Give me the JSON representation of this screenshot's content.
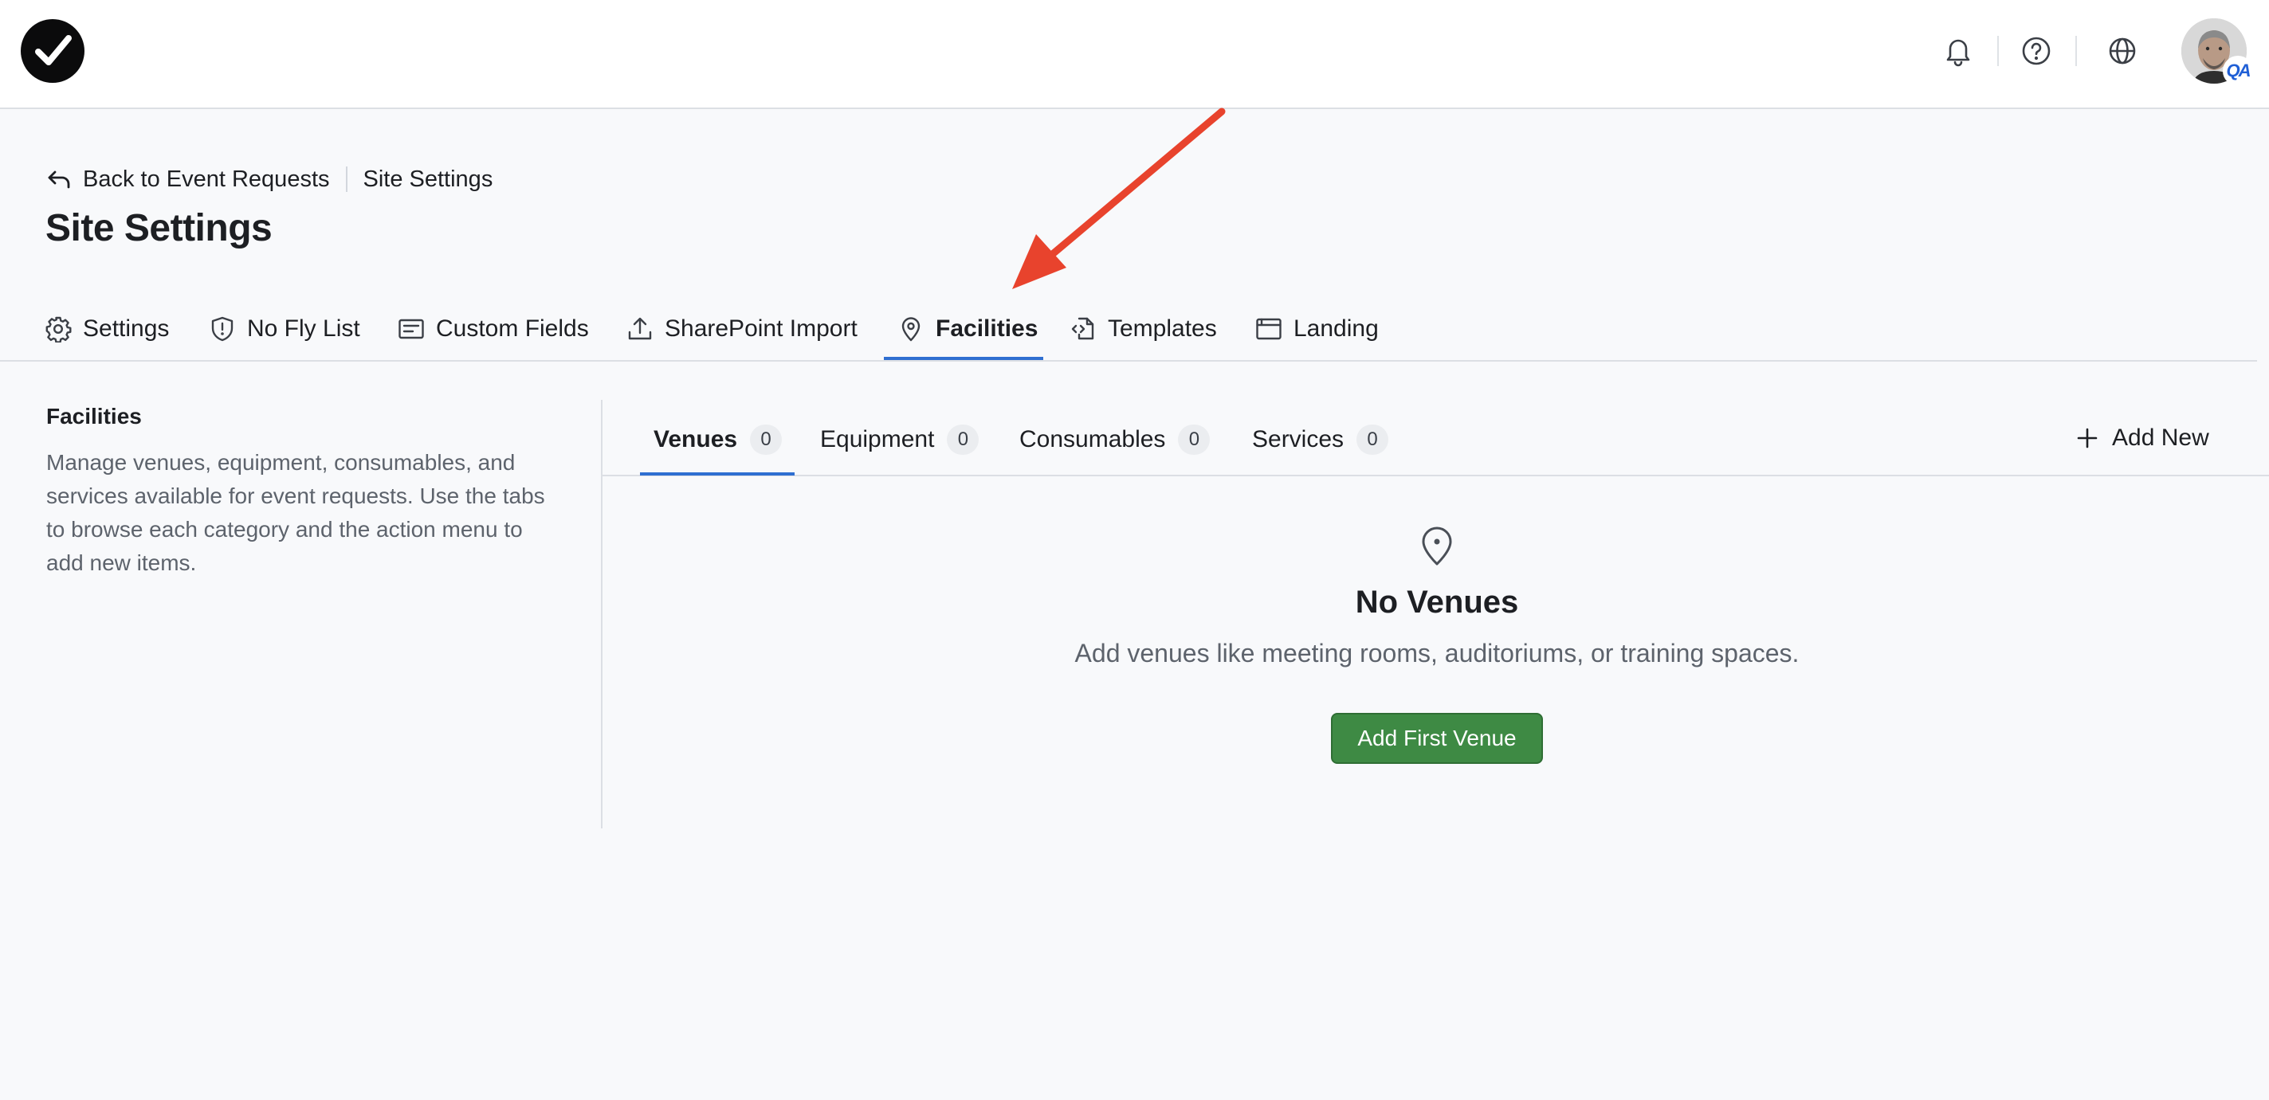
{
  "colors": {
    "accent": "#2f6fd1",
    "primary_button": "#3e8a44",
    "annotation_arrow": "#e8432d",
    "page_background": "#f8f9fb"
  },
  "topbar": {
    "logo_icon": "checkmark-circle-logo-icon",
    "icons": [
      "bell-icon",
      "help-circle-icon",
      "globe-icon"
    ],
    "avatar_badge": "QA"
  },
  "breadcrumb": {
    "back_label": "Back to Event Requests",
    "current": "Site Settings"
  },
  "page_title": "Site Settings",
  "main_tabs": [
    {
      "label": "Settings",
      "icon": "gear-icon"
    },
    {
      "label": "No Fly List",
      "icon": "shield-alert-icon"
    },
    {
      "label": "Custom Fields",
      "icon": "form-fields-icon"
    },
    {
      "label": "SharePoint Import",
      "icon": "upload-icon"
    },
    {
      "label": "Facilities",
      "icon": "map-pin-icon",
      "active": true
    },
    {
      "label": "Templates",
      "icon": "file-code-icon"
    },
    {
      "label": "Landing",
      "icon": "browser-window-icon"
    }
  ],
  "section": {
    "heading": "Facilities",
    "description": "Manage venues, equipment, consumables, and services available for event requests. Use the tabs to browse each category and the action menu to add new items."
  },
  "sub_tabs": [
    {
      "label": "Venues",
      "count": "0",
      "active": true
    },
    {
      "label": "Equipment",
      "count": "0"
    },
    {
      "label": "Consumables",
      "count": "0"
    },
    {
      "label": "Services",
      "count": "0"
    }
  ],
  "add_new_label": "Add New",
  "empty_state": {
    "icon": "map-pin-icon",
    "title": "No Venues",
    "description": "Add venues like meeting rooms, auditoriums, or training spaces.",
    "button_label": "Add First Venue"
  }
}
